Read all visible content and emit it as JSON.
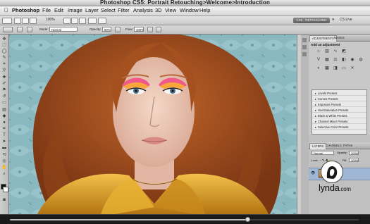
{
  "window": {
    "title": "Photoshop CS5: Portrait Retouching>Welcome>Introduction"
  },
  "menubar": {
    "app_name": "Photoshop",
    "items": [
      "File",
      "Edit",
      "Image",
      "Layer",
      "Select",
      "Filter",
      "Analysis",
      "3D",
      "View",
      "Window",
      "Help"
    ]
  },
  "appbar": {
    "zoom": "100%",
    "workspace": "CS5 - RETOUCHING",
    "cs_live": "CS Live"
  },
  "options": {
    "mode_label": "Mode:",
    "mode_value": "Normal",
    "opacity_label": "Opacity:",
    "opacity_value": "80%",
    "flow_label": "Flow:",
    "flow_value": "100%"
  },
  "panels": {
    "adjustments_tabs": [
      "ADJUSTMENTS",
      "MASKS"
    ],
    "add_adjustment": "Add an adjustment",
    "presets": [
      "Levels Presets",
      "Curves Presets",
      "Exposure Presets",
      "Hue/Saturation Presets",
      "Black & White Presets",
      "Channel Mixer Presets",
      "Selective Color Presets"
    ],
    "layers_tabs": [
      "LAYERS",
      "CHANNELS",
      "PATHS"
    ],
    "blend_mode": "Normal",
    "opacity_label": "Opacity:",
    "opacity_value": "100%",
    "lock_label": "Lock:",
    "fill_label": "Fill:",
    "fill_value": "100%"
  },
  "watermark": {
    "brand": "lynda",
    "suffix": ".com"
  },
  "video": {
    "progress": 0.68
  },
  "colors": {
    "accent": "#b8762f",
    "canvas_bg": "#86b6bf",
    "hair": "#a5501f",
    "jacket": "#d79a25"
  }
}
